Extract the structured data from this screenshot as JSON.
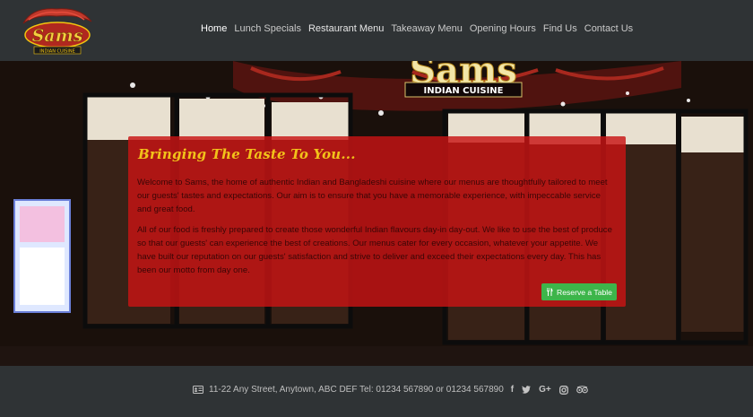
{
  "brand": {
    "logo_name": "Sams",
    "logo_tagline": "INDIAN CUISINE"
  },
  "nav": {
    "items": [
      {
        "label": "Home"
      },
      {
        "label": "Lunch Specials"
      },
      {
        "label": "Restaurant Menu"
      },
      {
        "label": "Takeaway Menu"
      },
      {
        "label": "Opening Hours"
      },
      {
        "label": "Find Us"
      },
      {
        "label": "Contact Us"
      }
    ],
    "active": "Home"
  },
  "hero": {
    "sign_name": "Sams",
    "sign_tagline": "INDIAN CUISINE",
    "title": "Bringing The Taste To You...",
    "paragraph1": "Welcome to Sams, the home of authentic Indian and Bangladeshi cuisine where our menus are thoughtfully tailored to meet our guests' tastes and expectations. Our aim is to ensure that you have a memorable experience, with impeccable service and great food.",
    "paragraph2": "All of our food is freshly prepared to create those wonderful Indian flavours day-in day-out. We like to use the best of produce so that our guests' can experience the best of creations. Our menus cater for every occasion, whatever your appetite. We have built our reputation on our guests' satisfaction and strive to deliver and exceed their expectations every day. This has been our motto from day one.",
    "reserve_label": "Reserve a Table"
  },
  "footer": {
    "address_text": "11-22 Any Street, Anytown, ABC DEF Tel: 01234 567890 or 01234 567890",
    "social_icons": [
      "facebook-icon",
      "twitter-icon",
      "google-plus-icon",
      "instagram-icon",
      "tripadvisor-icon"
    ]
  },
  "colors": {
    "header_bg": "#2f3335",
    "panel_red": "#c81414",
    "title_gold": "#f2c21a",
    "button_green": "#3db54a"
  }
}
